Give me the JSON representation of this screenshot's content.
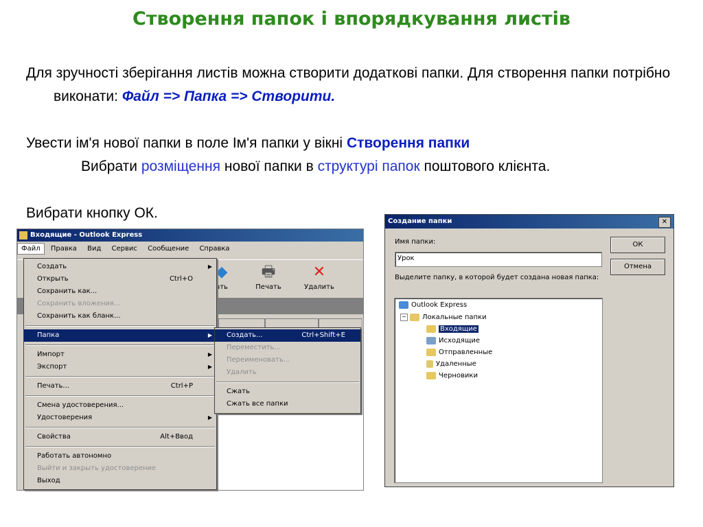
{
  "slide": {
    "title": "Створення папок і впорядкування листів",
    "p1_text": "Для зручності зберігання листів можна створити додаткові папки. Для створення папки потрібно виконати: ",
    "p1_highlight": "Файл => Папка => Створити.",
    "p2_text": "Увести ім'я нової папки в поле Ім'я папки у вікні ",
    "p2_highlight": "Створення папки",
    "p3_a": "Вибрати ",
    "p3_link1": "розміщення",
    "p3_b": " нової папки в ",
    "p3_link2": "структурі папок",
    "p3_c": " поштового клієнта.",
    "p4_text": "Вибрати кнопку ОК."
  },
  "outlook": {
    "window_title": "Входящие - Outlook Express",
    "menubar": [
      "Файл",
      "Правка",
      "Вид",
      "Сервис",
      "Сообщение",
      "Справка"
    ],
    "toolbar": [
      {
        "label": "ать",
        "icon": "send-icon"
      },
      {
        "label": "Печать",
        "icon": "printer-icon"
      },
      {
        "label": "Удалить",
        "icon": "delete-icon"
      }
    ],
    "file_menu": [
      {
        "label": "Создать",
        "shortcut": "",
        "submenu": true,
        "disabled": false
      },
      {
        "label": "Открыть",
        "shortcut": "Ctrl+O",
        "submenu": false,
        "disabled": false
      },
      {
        "label": "Сохранить как...",
        "shortcut": "",
        "submenu": false,
        "disabled": false
      },
      {
        "label": "Сохранить вложения...",
        "shortcut": "",
        "submenu": false,
        "disabled": true
      },
      {
        "label": "Сохранить как бланк...",
        "shortcut": "",
        "submenu": false,
        "disabled": false
      },
      {
        "label": "Папка",
        "shortcut": "",
        "submenu": true,
        "disabled": false,
        "selected": true
      },
      {
        "label": "Импорт",
        "shortcut": "",
        "submenu": true,
        "disabled": false
      },
      {
        "label": "Экспорт",
        "shortcut": "",
        "submenu": true,
        "disabled": false
      },
      {
        "label": "Печать...",
        "shortcut": "Ctrl+P",
        "submenu": false,
        "disabled": false
      },
      {
        "label": "Смена удостоверения...",
        "shortcut": "",
        "submenu": false,
        "disabled": false
      },
      {
        "label": "Удостоверения",
        "shortcut": "",
        "submenu": true,
        "disabled": false
      },
      {
        "label": "Свойства",
        "shortcut": "Alt+Ввод",
        "submenu": false,
        "disabled": false
      },
      {
        "label": "Работать автономно",
        "shortcut": "",
        "submenu": false,
        "disabled": false
      },
      {
        "label": "Выйти и закрыть удостоверение",
        "shortcut": "",
        "submenu": false,
        "disabled": true
      },
      {
        "label": "Выход",
        "shortcut": "",
        "submenu": false,
        "disabled": false
      }
    ],
    "folder_submenu": [
      {
        "label": "Создать...",
        "shortcut": "Ctrl+Shift+E",
        "disabled": false,
        "selected": true
      },
      {
        "label": "Переместить...",
        "shortcut": "",
        "disabled": true
      },
      {
        "label": "Переименовать...",
        "shortcut": "",
        "disabled": true
      },
      {
        "label": "Удалить",
        "shortcut": "",
        "disabled": true
      },
      {
        "label": "Сжать",
        "shortcut": "",
        "disabled": false
      },
      {
        "label": "Сжать все папки",
        "shortcut": "",
        "disabled": false
      }
    ]
  },
  "dialog": {
    "title": "Создание папки",
    "name_label": "Имя папки:",
    "name_value": "Урок",
    "location_label": "Выделите папку, в которой будет создана новая папка:",
    "ok_label": "ОК",
    "cancel_label": "Отмена",
    "close_label": "✕",
    "tree": [
      {
        "label": "Outlook Express",
        "level": 0,
        "selected": false
      },
      {
        "label": "Локальные папки",
        "level": 1,
        "selected": false
      },
      {
        "label": "Входящие",
        "level": 2,
        "selected": true
      },
      {
        "label": "Исходящие",
        "level": 2,
        "selected": false
      },
      {
        "label": "Отправленные",
        "level": 2,
        "selected": false
      },
      {
        "label": "Удаленные",
        "level": 2,
        "selected": false
      },
      {
        "label": "Черновики",
        "level": 2,
        "selected": false
      }
    ]
  },
  "colors": {
    "title_green": "#2e8b1e",
    "highlight_blue": "#0a1ebe",
    "win_face": "#d4d0c8",
    "selection": "#0a246a"
  }
}
